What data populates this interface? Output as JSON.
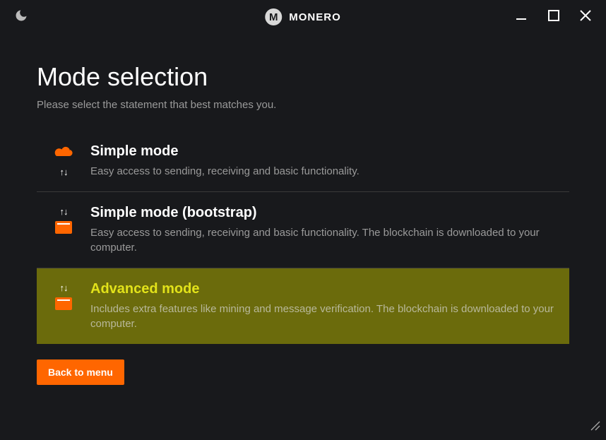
{
  "app": {
    "title": "MONERO"
  },
  "page": {
    "title": "Mode selection",
    "subtitle": "Please select the statement that best matches you."
  },
  "modes": [
    {
      "title": "Simple mode",
      "description": "Easy access to sending, receiving and basic functionality."
    },
    {
      "title": "Simple mode (bootstrap)",
      "description": "Easy access to sending, receiving and basic functionality. The blockchain is downloaded to your computer."
    },
    {
      "title": "Advanced mode",
      "description": "Includes extra features like mining and message verification. The blockchain is downloaded to your computer."
    }
  ],
  "buttons": {
    "back": "Back to menu"
  }
}
